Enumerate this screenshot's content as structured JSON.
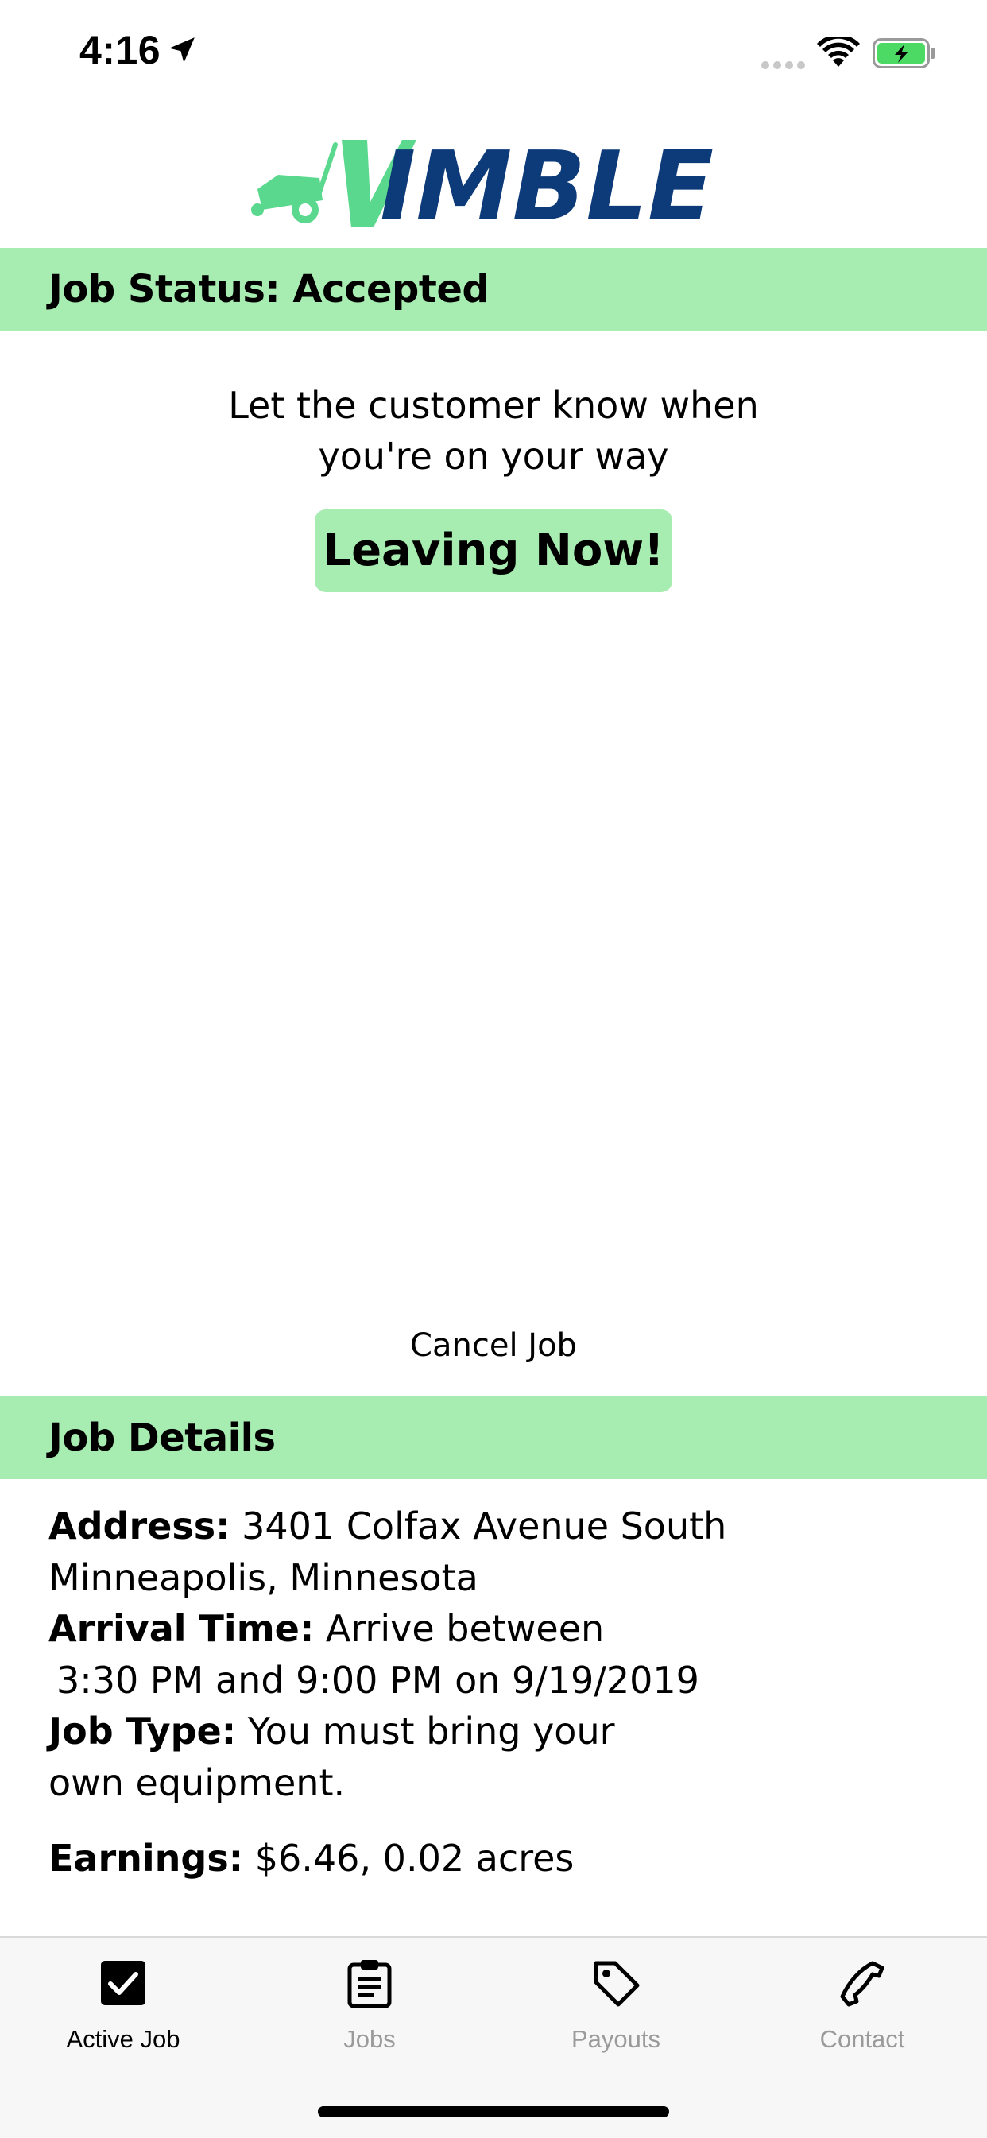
{
  "status_bar": {
    "time": "4:16",
    "battery_color": "#4cd964"
  },
  "logo": {
    "text": "VIMBLE",
    "accent_color": "#5ad88d",
    "text_color": "#0d3a78"
  },
  "job_status": {
    "title": "Job Status: Accepted",
    "prompt_line1": "Let the customer know when",
    "prompt_line2": "you're on your way",
    "leaving_button": "Leaving Now!",
    "cancel_link": "Cancel Job"
  },
  "job_details": {
    "title": "Job Details",
    "address_label": "Address:",
    "address_line1": "3401 Colfax Avenue South",
    "address_line2": "Minneapolis, Minnesota",
    "arrival_label": "Arrival Time:",
    "arrival_line1": "Arrive between",
    "arrival_line2": "3:30 PM and 9:00 PM on 9/19/2019",
    "job_type_label": "Job Type:",
    "job_type_line1": "You must bring your",
    "job_type_line2": "own equipment.",
    "earnings_label": "Earnings:",
    "earnings_value": "$6.46, 0.02 acres"
  },
  "tabs": [
    {
      "label": "Active Job",
      "icon": "checkbox-icon",
      "active": true
    },
    {
      "label": "Jobs",
      "icon": "clipboard-icon",
      "active": false
    },
    {
      "label": "Payouts",
      "icon": "tag-icon",
      "active": false
    },
    {
      "label": "Contact",
      "icon": "phone-icon",
      "active": false
    }
  ],
  "colors": {
    "section_bar": "#a7ecb0",
    "tab_inactive": "#9a9a9a"
  }
}
